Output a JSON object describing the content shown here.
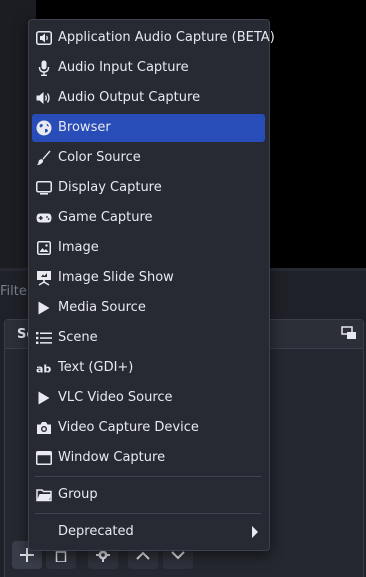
{
  "background": {
    "filter_label": "Filter",
    "dock_title": "Sc"
  },
  "menu": {
    "items": [
      {
        "label": "Application Audio Capture (BETA)",
        "icon": "audio-capture-icon"
      },
      {
        "label": "Audio Input Capture",
        "icon": "microphone-icon"
      },
      {
        "label": "Audio Output Capture",
        "icon": "speaker-icon"
      },
      {
        "label": "Browser",
        "icon": "globe-icon",
        "selected": true
      },
      {
        "label": "Color Source",
        "icon": "paintbrush-icon"
      },
      {
        "label": "Display Capture",
        "icon": "monitor-icon"
      },
      {
        "label": "Game Capture",
        "icon": "gamepad-icon"
      },
      {
        "label": "Image",
        "icon": "image-icon"
      },
      {
        "label": "Image Slide Show",
        "icon": "slideshow-icon"
      },
      {
        "label": "Media Source",
        "icon": "play-icon"
      },
      {
        "label": "Scene",
        "icon": "list-icon"
      },
      {
        "label": "Text (GDI+)",
        "icon": "text-icon"
      },
      {
        "label": "VLC Video Source",
        "icon": "play-icon"
      },
      {
        "label": "Video Capture Device",
        "icon": "camera-icon"
      },
      {
        "label": "Window Capture",
        "icon": "window-icon"
      }
    ],
    "group_label": "Group",
    "deprecated_label": "Deprecated"
  },
  "colors": {
    "selected": "#284cb8",
    "menu_bg": "#272a33"
  }
}
